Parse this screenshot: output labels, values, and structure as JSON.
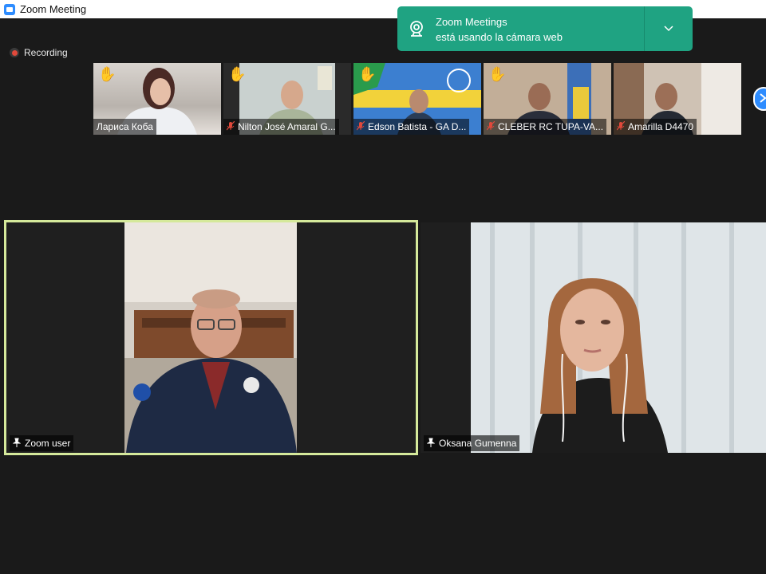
{
  "window": {
    "title": "Zoom Meeting"
  },
  "recording": {
    "label": "Recording"
  },
  "notification": {
    "line1": "Zoom Meetings",
    "line2": "está usando la cámara web"
  },
  "thumbnails": [
    {
      "name": "Лариса Коба",
      "muted": false,
      "hand_raised": true
    },
    {
      "name": "Nilton José Amaral G...",
      "muted": true,
      "hand_raised": true
    },
    {
      "name": "Edson Batista - GA D...",
      "muted": true,
      "hand_raised": true
    },
    {
      "name": "CLEBER RC TUPA-VA...",
      "muted": true,
      "hand_raised": true
    },
    {
      "name": "Amarilla D4470",
      "muted": true,
      "hand_raised": false
    }
  ],
  "main_tiles": [
    {
      "name": "Zoom user",
      "active_speaker": true
    },
    {
      "name": "Oksana Gumenna",
      "active_speaker": false
    }
  ],
  "colors": {
    "accent": "#2d8cff",
    "toast": "#1fa382",
    "active_speaker_border": "#d5e99b",
    "recording": "#e0493b",
    "hand": "#f5c242"
  },
  "icons": {
    "app": "zoom-camera-icon",
    "recording": "record-icon",
    "webcam": "webcam-icon",
    "hand": "raised-hand-icon",
    "mute": "mic-muted-icon",
    "pin": "pin-icon",
    "next": "chevron-right-icon",
    "toast_expand": "chevron-down-icon"
  }
}
